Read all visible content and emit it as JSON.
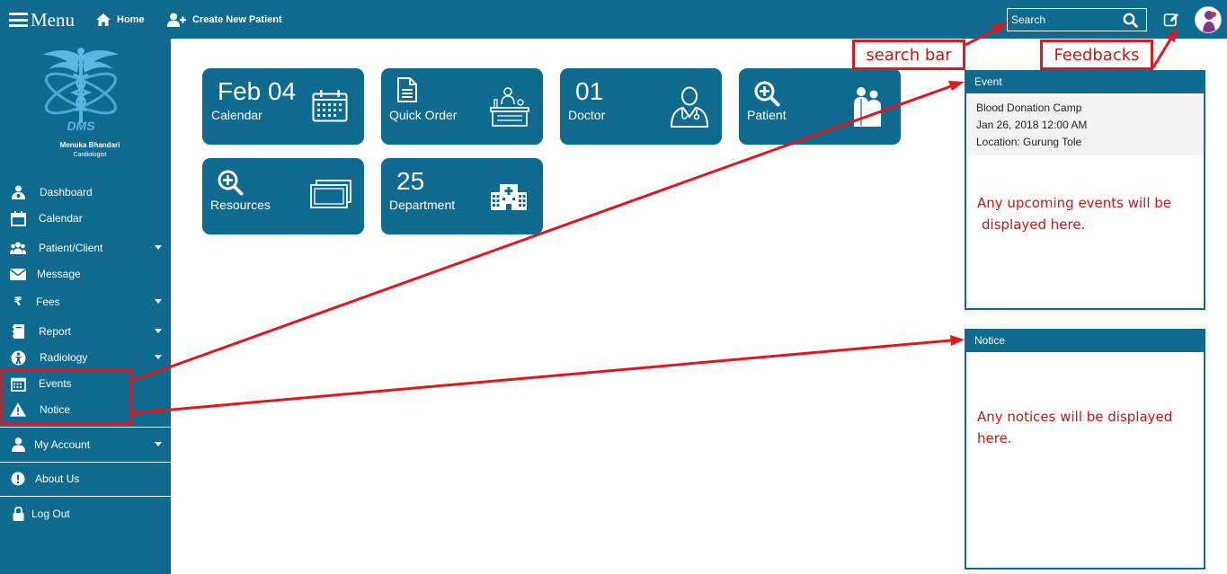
{
  "topbar": {
    "menu_label": "Menu",
    "home_label": "Home",
    "create_patient_label": "Create New Patient",
    "search_placeholder": "Search"
  },
  "sidebar": {
    "user_name": "Menuka Bhandari",
    "user_role": "Cardiologist",
    "logo_text": "DMS",
    "items": [
      {
        "label": "Dashboard",
        "icon": "dashboard-icon",
        "has_caret": false
      },
      {
        "label": "Calendar",
        "icon": "calendar-icon",
        "has_caret": false
      },
      {
        "label": "Patient/Client",
        "icon": "patients-icon",
        "has_caret": true
      },
      {
        "label": "Message",
        "icon": "envelope-icon",
        "has_caret": false
      },
      {
        "label": "Fees",
        "icon": "rupee-icon",
        "has_caret": true
      },
      {
        "label": "Report",
        "icon": "report-book-icon",
        "has_caret": true
      },
      {
        "label": "Radiology",
        "icon": "radiology-icon",
        "has_caret": true
      },
      {
        "label": "Events",
        "icon": "events-calendar-icon",
        "has_caret": false
      },
      {
        "label": "Notice",
        "icon": "warning-icon",
        "has_caret": false
      },
      {
        "label": "My Account",
        "icon": "user-icon",
        "has_caret": true
      },
      {
        "label": "About Us",
        "icon": "info-icon",
        "has_caret": false
      },
      {
        "label": "Log Out",
        "icon": "lock-icon",
        "has_caret": false
      }
    ]
  },
  "tiles": [
    {
      "value": "Feb 04",
      "label": "Calendar",
      "icon": "calendar-grid-icon"
    },
    {
      "value": "",
      "label": "Quick Order",
      "icon": "document-icon"
    },
    {
      "value": "01",
      "label": "Doctor",
      "icon": "doctor-icon"
    },
    {
      "value": "",
      "label": "Patient",
      "icon": "search-plus-icon"
    },
    {
      "value": "",
      "label": "Resources",
      "icon": "search-plus-icon"
    },
    {
      "value": "25",
      "label": "Department",
      "icon": "hospital-icon"
    }
  ],
  "event_panel": {
    "title": "Event",
    "event_name": "Blood Donation Camp",
    "event_date": "Jan 26, 2018 12:00 AM",
    "event_location": "Location: Gurung Tole",
    "note_line1": "Any upcoming events will be",
    "note_line2": "displayed here."
  },
  "notice_panel": {
    "title": "Notice",
    "note_line1": "Any notices will be displayed",
    "note_line2": "here."
  },
  "annotations": {
    "search_bar": "search bar",
    "feedbacks": "Feedbacks"
  },
  "colors": {
    "primary": "#0e6a8f",
    "annotation_red": "#e2161c",
    "note_text_red": "#cc1515"
  }
}
